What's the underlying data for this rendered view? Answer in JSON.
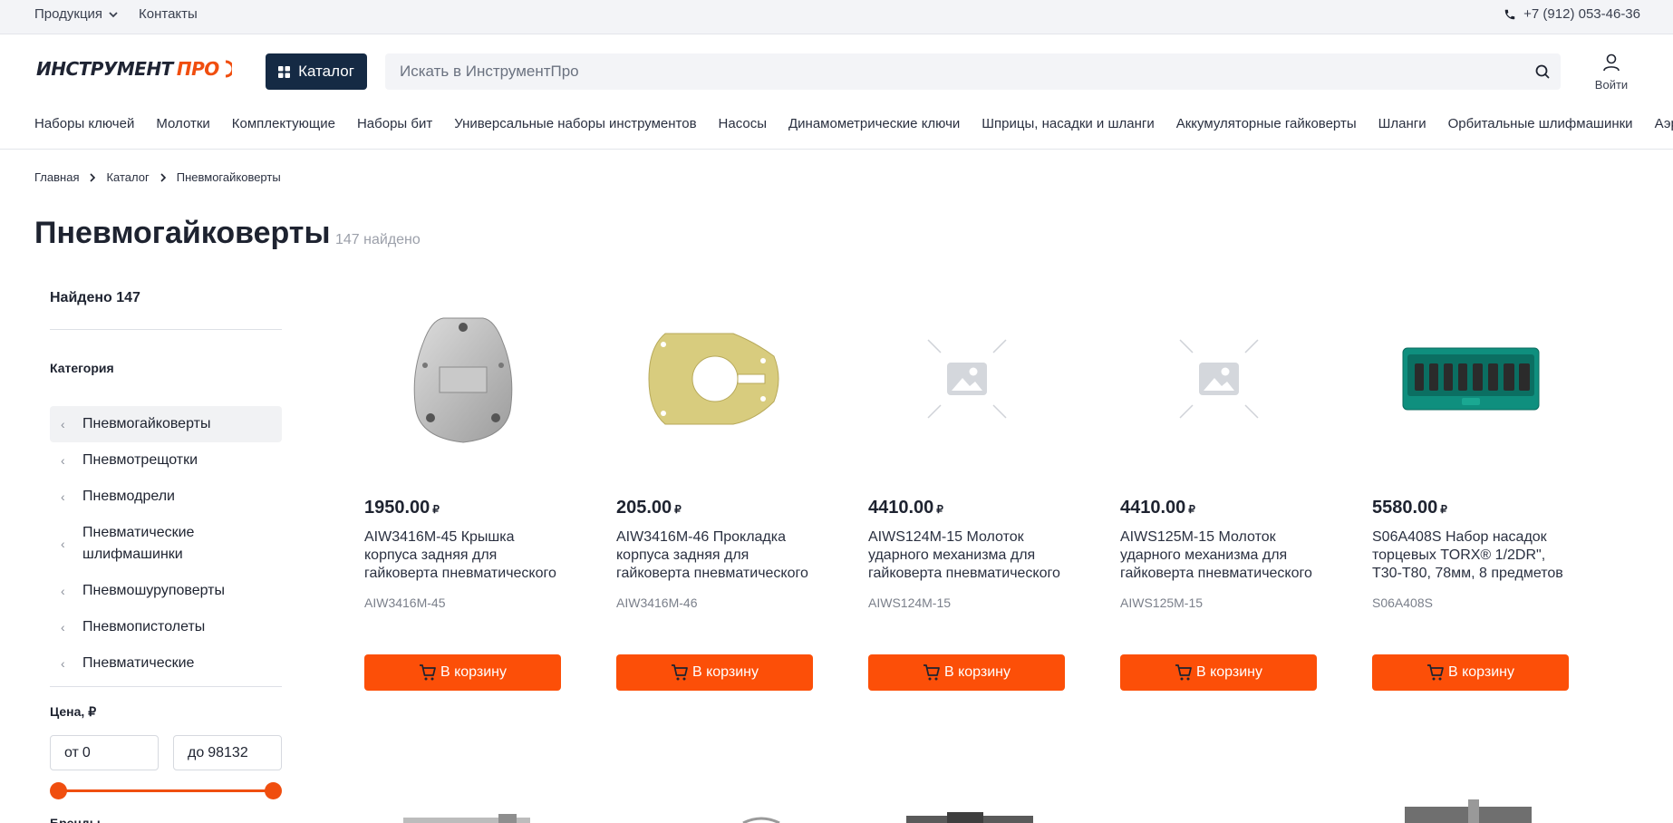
{
  "topbar": {
    "products_label": "Продукция",
    "contacts_label": "Контакты",
    "phone": "+7 (912) 053-46-36"
  },
  "header": {
    "logo_part1": "ИНСТРУМЕНТ",
    "logo_part2": "ПРО",
    "catalog_label": "Каталог",
    "search_placeholder": "Искать в ИнструментПро",
    "login_label": "Войти"
  },
  "category_nav": [
    "Наборы ключей",
    "Молотки",
    "Комплектующие",
    "Наборы бит",
    "Универсальные наборы инструментов",
    "Насосы",
    "Динамометрические ключи",
    "Шприцы, насадки и шланги",
    "Аккумуляторные гайковерты",
    "Шланги",
    "Орбитальные шлифмашинки",
    "Аэрографы"
  ],
  "breadcrumbs": [
    "Главная",
    "Каталог",
    "Пневмогайковерты"
  ],
  "page": {
    "title": "Пневмогайковерты",
    "found_count": "147 найдено"
  },
  "sidebar": {
    "found_label": "Найдено 147",
    "category_title": "Категория",
    "categories": [
      {
        "label": "Пневмогайковерты",
        "active": true
      },
      {
        "label": "Пневмотрещотки",
        "active": false
      },
      {
        "label": "Пневмодрели",
        "active": false
      },
      {
        "label": "Пневматические шлифмашинки",
        "active": false
      },
      {
        "label": "Пневмошуруповерты",
        "active": false
      },
      {
        "label": "Пневмопистолеты",
        "active": false
      },
      {
        "label": "Пневматические",
        "active": false
      }
    ],
    "price_title": "Цена, ₽",
    "price_from_prefix": "от",
    "price_from_value": "0",
    "price_to_prefix": "до",
    "price_to_value": "98132",
    "brands_title": "Бренды"
  },
  "colors": {
    "accent": "#fc4f08",
    "catalog_button": "#152a44",
    "topbar_bg": "#f3f4f7"
  },
  "products": [
    {
      "price": "1950.00",
      "currency": "₽",
      "name": "AIW3416M-45 Крышка корпуса задняя для гайковерта пневматического",
      "sku": "AIW3416M-45",
      "image": "cover-plate",
      "cart_label": "В корзину"
    },
    {
      "price": "205.00",
      "currency": "₽",
      "name": "AIW3416M-46 Прокладка корпуса задняя для гайковерта пневматического",
      "sku": "AIW3416M-46",
      "image": "gasket",
      "cart_label": "В корзину"
    },
    {
      "price": "4410.00",
      "currency": "₽",
      "name": "AIWS124M-15 Молоток ударного механизма для гайковерта пневматического",
      "sku": "AIWS124M-15",
      "image": "placeholder",
      "cart_label": "В корзину"
    },
    {
      "price": "4410.00",
      "currency": "₽",
      "name": "AIWS125M-15 Молоток ударного механизма для гайковерта пневматического",
      "sku": "AIWS125M-15",
      "image": "placeholder",
      "cart_label": "В корзину"
    },
    {
      "price": "5580.00",
      "currency": "₽",
      "name": "S06A408S Набор насадок торцевых TORX® 1/2DR\", T30-T80, 78мм, 8 предметов",
      "sku": "S06A408S",
      "image": "socket-set",
      "cart_label": "В корзину"
    }
  ]
}
